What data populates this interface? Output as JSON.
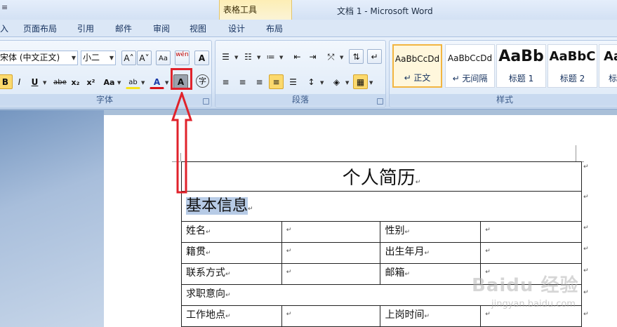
{
  "window": {
    "title": "文档 1 - Microsoft Word",
    "context_tab_group": "表格工具",
    "quick_access_glyph": "≡"
  },
  "tabs": [
    {
      "label": "入"
    },
    {
      "label": "页面布局"
    },
    {
      "label": "引用"
    },
    {
      "label": "邮件"
    },
    {
      "label": "审阅"
    },
    {
      "label": "视图"
    },
    {
      "label": "设计"
    },
    {
      "label": "布局"
    }
  ],
  "font_group": {
    "label": "字体",
    "font_name": "宋体 (中文正文)",
    "font_size": "小二",
    "buttons": {
      "grow": "A˄",
      "shrink": "A˅",
      "clear": "Aa",
      "phonetic": "wén",
      "border": "A",
      "bold": "B",
      "italic": "I",
      "underline": "U",
      "strike": "abe",
      "subscript": "x₂",
      "superscript": "x²",
      "change_case": "Aa",
      "highlight": "ab",
      "font_color": "A",
      "shading": "A",
      "enclose": "字"
    }
  },
  "paragraph_group": {
    "label": "段落"
  },
  "styles_group": {
    "label": "样式",
    "items": [
      {
        "sample": "AaBbCcDd",
        "name": "↵ 正文"
      },
      {
        "sample": "AaBbCcDd",
        "name": "↵ 无间隔"
      },
      {
        "sample": "AaBb",
        "name": "标题 1"
      },
      {
        "sample": "AaBbC",
        "name": "标题 2"
      },
      {
        "sample": "Aa",
        "name": "标"
      }
    ]
  },
  "document": {
    "para_mark": "↵",
    "title": "个人简历",
    "section": "基本信息",
    "rows": [
      {
        "c1": "姓名",
        "c2": "",
        "c3": "性别",
        "c4": ""
      },
      {
        "c1": "籍贯",
        "c2": "",
        "c3": "出生年月",
        "c4": ""
      },
      {
        "c1": "联系方式",
        "c2": "",
        "c3": "邮箱",
        "c4": ""
      },
      {
        "c1": "求职意向"
      },
      {
        "c1": "工作地点",
        "c2": "",
        "c3": "上岗时间",
        "c4": ""
      }
    ]
  },
  "watermark": {
    "text": "Baidu 经验",
    "sub": "jingyan.baidu.com"
  },
  "colors": {
    "annotation": "#e0222b",
    "selection": "#b7cbe6",
    "active_button": "#fbd96d"
  }
}
